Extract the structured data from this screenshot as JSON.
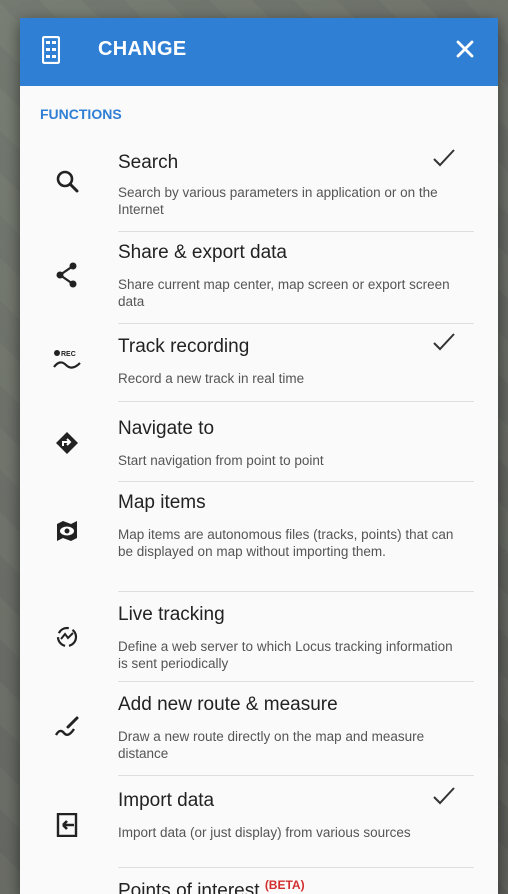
{
  "header": {
    "title": "CHANGE",
    "icon": "panel-icon",
    "close_icon": "close-icon",
    "color": "#2f7fd4"
  },
  "section": {
    "title": "FUNCTIONS"
  },
  "items": [
    {
      "title": "Search",
      "desc": "Search by various parameters in application or on the Internet",
      "icon": "search-icon",
      "checked": true
    },
    {
      "title": "Share & export data",
      "desc": "Share current map center, map screen or export screen data",
      "icon": "share-icon",
      "checked": false
    },
    {
      "title": "Track recording",
      "desc": "Record a new track in real time",
      "icon": "track-recording-icon",
      "checked": true
    },
    {
      "title": "Navigate to",
      "desc": "Start navigation from point to point",
      "icon": "navigate-icon",
      "checked": false
    },
    {
      "title": "Map items",
      "desc": "Map items are autonomous files (tracks, points) that can be displayed on map without importing them.",
      "icon": "map-items-icon",
      "checked": false
    },
    {
      "title": "Live tracking",
      "desc": "Define a web server to which Locus tracking information is sent periodically",
      "icon": "live-tracking-icon",
      "checked": false
    },
    {
      "title": "Add new route & measure",
      "desc": "Draw a new route directly on the map and measure distance",
      "icon": "route-measure-icon",
      "checked": false
    },
    {
      "title": "Import data",
      "desc": "Import data (or just display) from various sources",
      "icon": "import-icon",
      "checked": true
    },
    {
      "title": "Points of interest",
      "badge": "(BETA)",
      "icon": "poi-icon",
      "checked": false
    }
  ]
}
